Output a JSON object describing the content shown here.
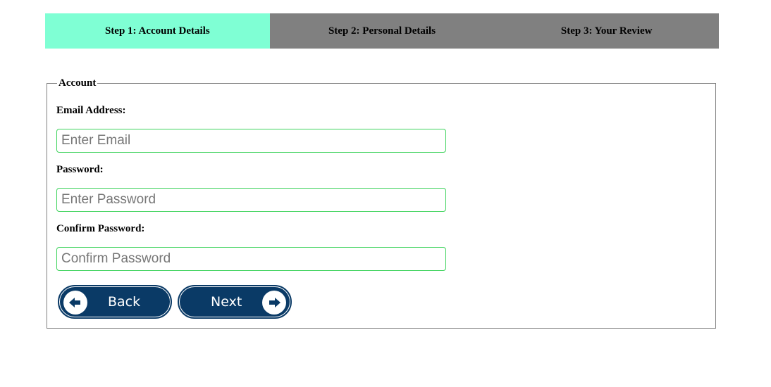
{
  "steps": [
    {
      "label": "Step 1: Account Details",
      "active": true
    },
    {
      "label": "Step 2: Personal Details",
      "active": false
    },
    {
      "label": "Step 3: Your Review",
      "active": false
    }
  ],
  "form": {
    "legend": "Account",
    "fields": [
      {
        "label": "Email Address:",
        "placeholder": "Enter Email",
        "value": ""
      },
      {
        "label": "Password:",
        "placeholder": "Enter Password",
        "value": ""
      },
      {
        "label": "Confirm Password:",
        "placeholder": "Confirm Password",
        "value": ""
      }
    ]
  },
  "buttons": {
    "back_label": "Back",
    "back_icon": "arrow-left-icon",
    "next_label": "Next",
    "next_icon": "arrow-right-icon"
  },
  "colors": {
    "active_step": "#7fffd4",
    "inactive_step": "#808080",
    "input_border": "#3fd35d",
    "button": "#0a3a66"
  }
}
